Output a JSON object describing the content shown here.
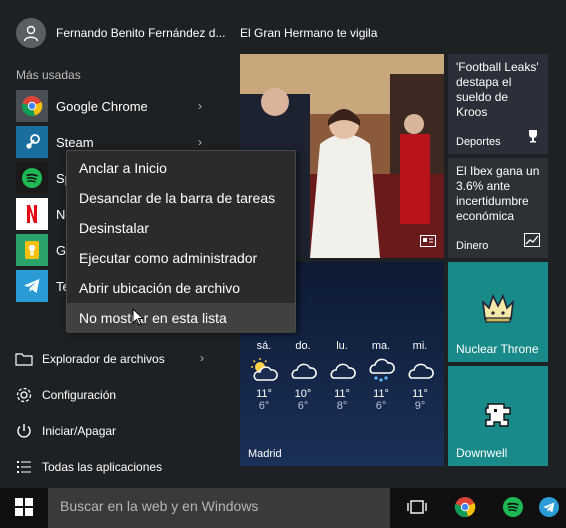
{
  "user": {
    "name": "Fernando Benito Fernández d..."
  },
  "sections": {
    "most_used": "Más usadas"
  },
  "apps": [
    {
      "label": "Google Chrome",
      "icon": "chrome-icon"
    },
    {
      "label": "Steam",
      "icon": "steam-icon"
    },
    {
      "label": "Sp",
      "icon": "spotify-icon"
    },
    {
      "label": "Ne",
      "icon": "netflix-icon"
    },
    {
      "label": "Go",
      "icon": "google-keep-icon"
    },
    {
      "label": "Te",
      "icon": "telegram-icon"
    }
  ],
  "system": [
    {
      "label": "Explorador de archivos",
      "icon": "folder-icon"
    },
    {
      "label": "Configuración",
      "icon": "gear-icon"
    },
    {
      "label": "Iniciar/Apagar",
      "icon": "power-icon"
    },
    {
      "label": "Todas las aplicaciones",
      "icon": "list-icon"
    }
  ],
  "context_menu": [
    "Anclar a Inicio",
    "Desanclar de la barra de tareas",
    "Desinstalar",
    "Ejecutar como administrador",
    "Abrir ubicación de archivo",
    "No mostrar en esta lista"
  ],
  "tiles": {
    "group_title": "El Gran Hermano te vigila",
    "sports": {
      "headline": "'Football Leaks' destapa el sueldo de Kroos",
      "label": "Deportes"
    },
    "money": {
      "headline": "El Ibex gana un 3.6% ante incertidumbre económica",
      "label": "Dinero"
    },
    "nuclear": {
      "label": "Nuclear Throne"
    },
    "downwell": {
      "label": "Downwell"
    },
    "weather": {
      "city": "Madrid",
      "days": [
        {
          "day": "sá.",
          "icon": "partly-sunny-icon",
          "high": "11°",
          "low": "6°"
        },
        {
          "day": "do.",
          "icon": "cloud-icon",
          "high": "10°",
          "low": "6°"
        },
        {
          "day": "lu.",
          "icon": "cloud-icon",
          "high": "11°",
          "low": "8°"
        },
        {
          "day": "ma.",
          "icon": "rain-icon",
          "high": "11°",
          "low": "6°"
        },
        {
          "day": "mi.",
          "icon": "cloud-icon",
          "high": "11°",
          "low": "9°"
        }
      ]
    }
  },
  "taskbar": {
    "search_placeholder": "Buscar en la web y en Windows"
  },
  "colors": {
    "accent": "#1e8a8a",
    "tile_teal": "#198a8a",
    "sports_bg": "#2b2f3a",
    "money_bg": "#2d3136"
  }
}
